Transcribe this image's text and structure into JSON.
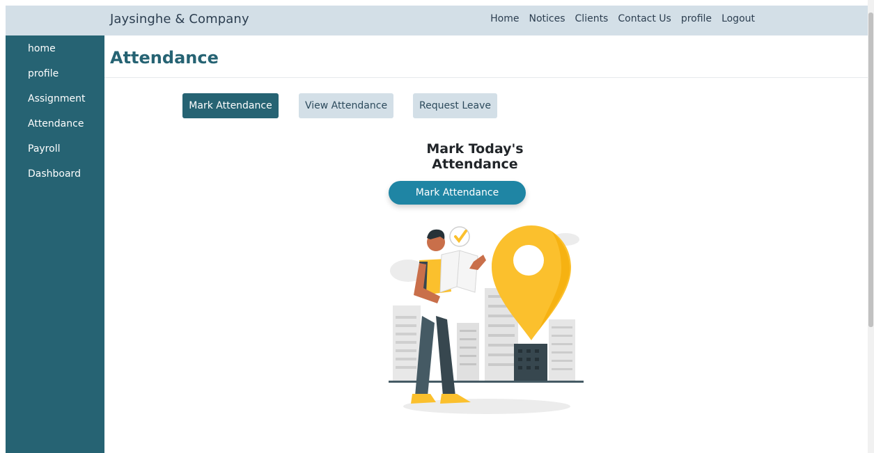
{
  "brand": "Jaysinghe & Company",
  "top_nav": [
    "Home",
    "Notices",
    "Clients",
    "Contact Us",
    "profile",
    "Logout"
  ],
  "sidebar": [
    "home",
    "profile",
    "Assignment",
    "Attendance",
    "Payroll",
    "Dashboard"
  ],
  "page_title": "Attendance",
  "tabs": {
    "mark": "Mark Attendance",
    "view": "View Attendance",
    "leave": "Request Leave"
  },
  "section_title": "Mark Today's Attendance",
  "mark_button": "Mark Attendance",
  "colors": {
    "sidebar": "#266373",
    "topbar": "#d3dfe7",
    "accent": "#1f85a4",
    "pin": "#fbc02d"
  }
}
